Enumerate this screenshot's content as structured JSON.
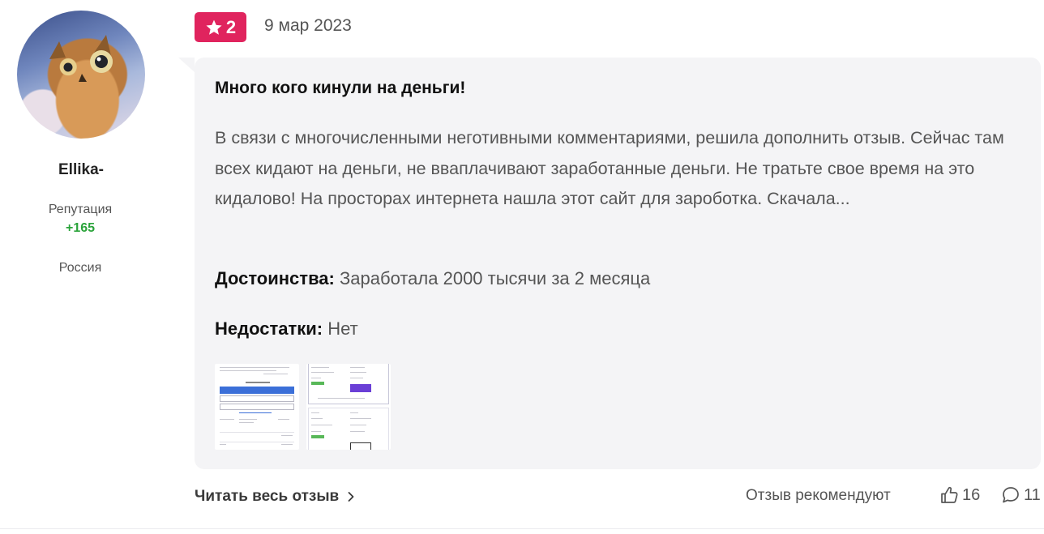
{
  "user": {
    "name": "Ellika-",
    "reputation_label": "Репутация",
    "reputation_value": "+165",
    "country": "Россия"
  },
  "review": {
    "rating": "2",
    "date": "9 мар 2023",
    "title": "Много кого кинули на деньги!",
    "text": "В связи с многочисленными неготивными комментариями, решила дополнить отзыв. Сейчас там всех кидают на деньги, не вваплачивают заработанные деньги. Не тратьте свое время на это кидалово! На просторах интернета нашла этот сайт для зароботка. Скачала...",
    "pros_label": "Достоинства:",
    "pros_value": "Заработала 2000 тысячи за 2 месяца",
    "cons_label": "Недостатки:",
    "cons_value": "Нет",
    "photos": [
      {
        "icon": "screenshot-thumbnail"
      },
      {
        "icon": "screenshot-thumbnail"
      }
    ]
  },
  "footer": {
    "read_more": "Читать весь отзыв",
    "recommend_label": "Отзыв рекомендуют",
    "likes": "16",
    "comments": "11"
  },
  "colors": {
    "rating_badge": "#e0245e",
    "reputation": "#2aa33a",
    "card_bg": "#f4f4f6"
  }
}
